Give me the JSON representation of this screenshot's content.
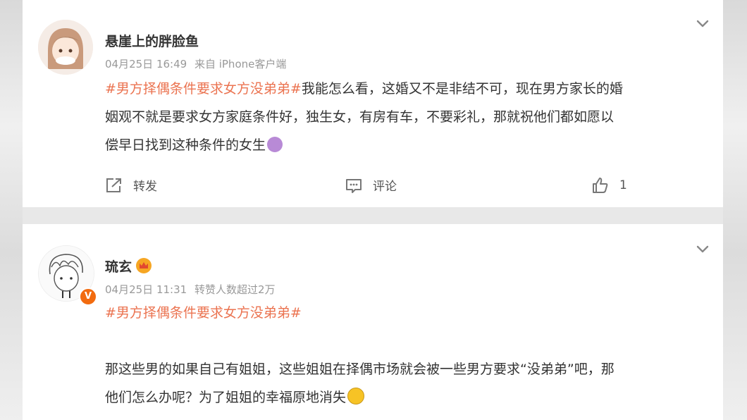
{
  "posts": [
    {
      "username": "悬崖上的胖脸鱼",
      "date": "04月25日 16:49",
      "source": "来自 iPhone客户端",
      "hashtag": "#男方择偶条件要求女方没弟弟#",
      "line1_rest": "我能怎么看，这婚又不是非结不可，现在男方家长的婚",
      "line2": "姻观不就是要求女方家庭条件好，独生女，有房有车，不要彩礼，那就祝他们都如愿以",
      "line3": "偿早日找到这种条件的女生",
      "actions": {
        "repost": "转发",
        "comment": "评论",
        "like_count": "1"
      }
    },
    {
      "username": "琉玄",
      "date": "04月25日 11:31",
      "stat": "转赞人数超过2万",
      "hashtag": "#男方择偶条件要求女方没弟弟#",
      "line1": "那这些男的如果自己有姐姐，这些姐姐在择偶市场就会被一些男方要求“没弟弟”吧，那",
      "line2": "他们怎么办呢？为了姐姐的幸福原地消失",
      "verified_badge": "V"
    }
  ],
  "colors": {
    "hashtag": "#eb7350",
    "verified": "#f26b0f",
    "meta": "#999999"
  },
  "icons": [
    "chevron-down-icon",
    "repost-icon",
    "comment-icon",
    "like-icon",
    "crown-icon",
    "shrug-emoji",
    "dizzy-emoji",
    "verified-icon"
  ]
}
